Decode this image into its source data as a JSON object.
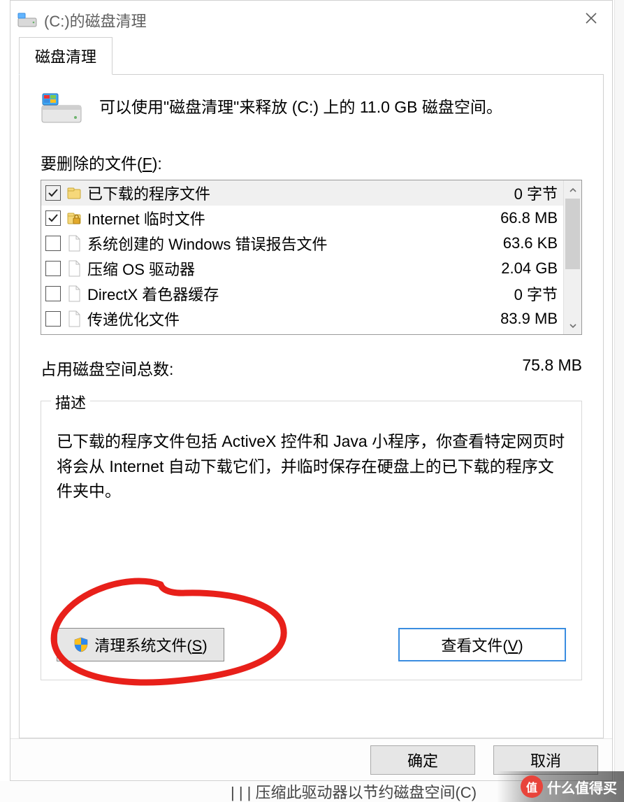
{
  "window": {
    "title": "(C:)的磁盘清理"
  },
  "tab": {
    "label": "磁盘清理"
  },
  "summary": "可以使用\"磁盘清理\"来释放  (C:) 上的 11.0 GB 磁盘空间。",
  "files_label_pre": "要删除的文件(",
  "files_label_u": "F",
  "files_label_post": "):",
  "files": [
    {
      "checked": true,
      "icon": "folder",
      "name": "已下载的程序文件",
      "size": "0 字节",
      "selected": true
    },
    {
      "checked": true,
      "icon": "lock-folder",
      "name": "Internet 临时文件",
      "size": "66.8 MB",
      "selected": false
    },
    {
      "checked": false,
      "icon": "file",
      "name": "系统创建的 Windows 错误报告文件",
      "size": "63.6 KB",
      "selected": false
    },
    {
      "checked": false,
      "icon": "file",
      "name": "压缩 OS 驱动器",
      "size": "2.04 GB",
      "selected": false
    },
    {
      "checked": false,
      "icon": "file",
      "name": "DirectX 着色器缓存",
      "size": "0 字节",
      "selected": false
    },
    {
      "checked": false,
      "icon": "file",
      "name": "传递优化文件",
      "size": "83.9 MB",
      "selected": false
    }
  ],
  "totals": {
    "label": "占用磁盘空间总数:",
    "value": "75.8 MB"
  },
  "description": {
    "title": "描述",
    "body": "已下载的程序文件包括 ActiveX 控件和 Java 小程序，你查看特定网页时将会从 Internet 自动下载它们，并临时保存在硬盘上的已下载的程序文件夹中。"
  },
  "buttons": {
    "clean_sys_pre": "清理系统文件(",
    "clean_sys_u": "S",
    "clean_sys_post": ")",
    "view_files_pre": "查看文件(",
    "view_files_u": "V",
    "view_files_post": ")",
    "ok": "确定",
    "cancel": "取消"
  },
  "watermark": {
    "badge": "值",
    "text": "什么值得买"
  },
  "bg_strip_bottom": "| | | 压缩此驱动器以节约磁盘空间(C)"
}
